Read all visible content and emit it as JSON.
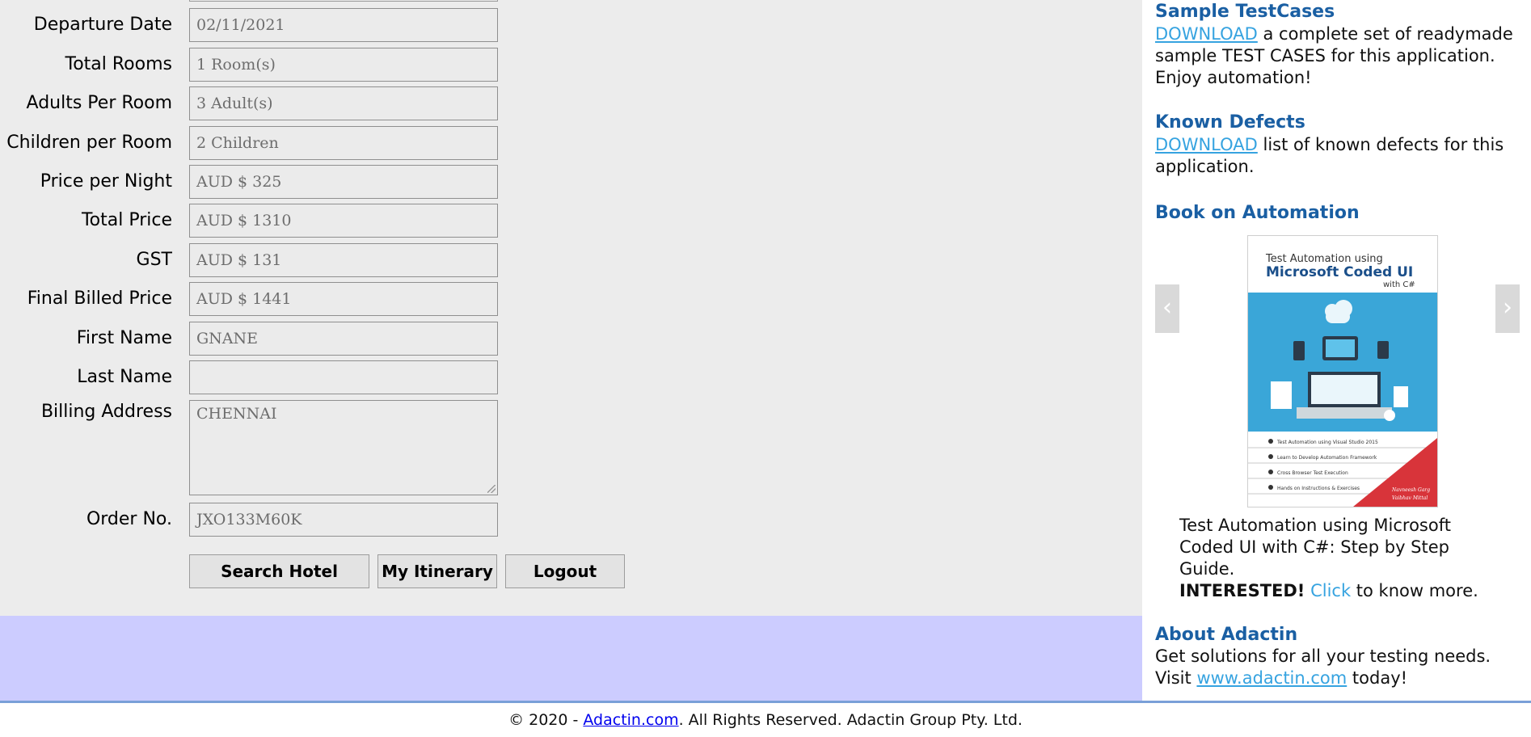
{
  "form": {
    "fields": [
      {
        "label": "Departure Date",
        "value": "02/11/2021"
      },
      {
        "label": "Total Rooms",
        "value": "1 Room(s)"
      },
      {
        "label": "Adults Per Room",
        "value": "3 Adult(s)"
      },
      {
        "label": "Children per Room",
        "value": "2 Children"
      },
      {
        "label": "Price per Night",
        "value": "AUD $ 325"
      },
      {
        "label": "Total Price",
        "value": "AUD $ 1310"
      },
      {
        "label": "GST",
        "value": "AUD $ 131"
      },
      {
        "label": "Final Billed Price",
        "value": "AUD $ 1441"
      },
      {
        "label": "First Name",
        "value": "GNANE"
      },
      {
        "label": "Last Name",
        "value": ""
      },
      {
        "label": "Billing Address",
        "value": "CHENNAI"
      },
      {
        "label": "Order No.",
        "value": "JXO133M60K"
      }
    ],
    "buttons": {
      "search_hotel": "Search Hotel",
      "my_itinerary": "My Itinerary",
      "logout": "Logout"
    }
  },
  "sidebar": {
    "testcases": {
      "heading": "Sample TestCases",
      "link": "DOWNLOAD",
      "text": " a complete set of readymade sample TEST CASES for this application. Enjoy automation!"
    },
    "defects": {
      "heading": "Known Defects",
      "link": "DOWNLOAD",
      "text": " list of known defects for this application."
    },
    "book": {
      "heading": "Book on Automation",
      "cover_line1": "Test Automation using",
      "cover_line2": "Microsoft Coded UI",
      "cover_line3": "with C#",
      "cover_bullets": [
        "Test Automation using Visual Studio 2015",
        "Learn to Develop Automation Framework",
        "Cross Browser Test Execution",
        "Hands on Instructions & Exercises"
      ],
      "cover_authors": [
        "Navneesh Garg",
        "Vaibhav Mittal"
      ],
      "caption": "Test Automation using Microsoft Coded UI with C#: Step by Step Guide.",
      "interested_label": "INTERESTED!",
      "click_link": "Click",
      "know_more": " to know more."
    },
    "about": {
      "heading": "About Adactin",
      "text1": "Get solutions for all your testing needs.",
      "visit": "Visit ",
      "link": "www.adactin.com",
      "today": " today!"
    }
  },
  "footer": {
    "prefix": "© 2020 - ",
    "link": "Adactin.com",
    "suffix": ". All Rights Reserved. Adactin Group Pty. Ltd."
  },
  "colors": {
    "panel_bg": "#ececec",
    "band_bg": "#ccccff",
    "heading_blue": "#1a5fa3",
    "link_blue": "#36a3e0"
  }
}
